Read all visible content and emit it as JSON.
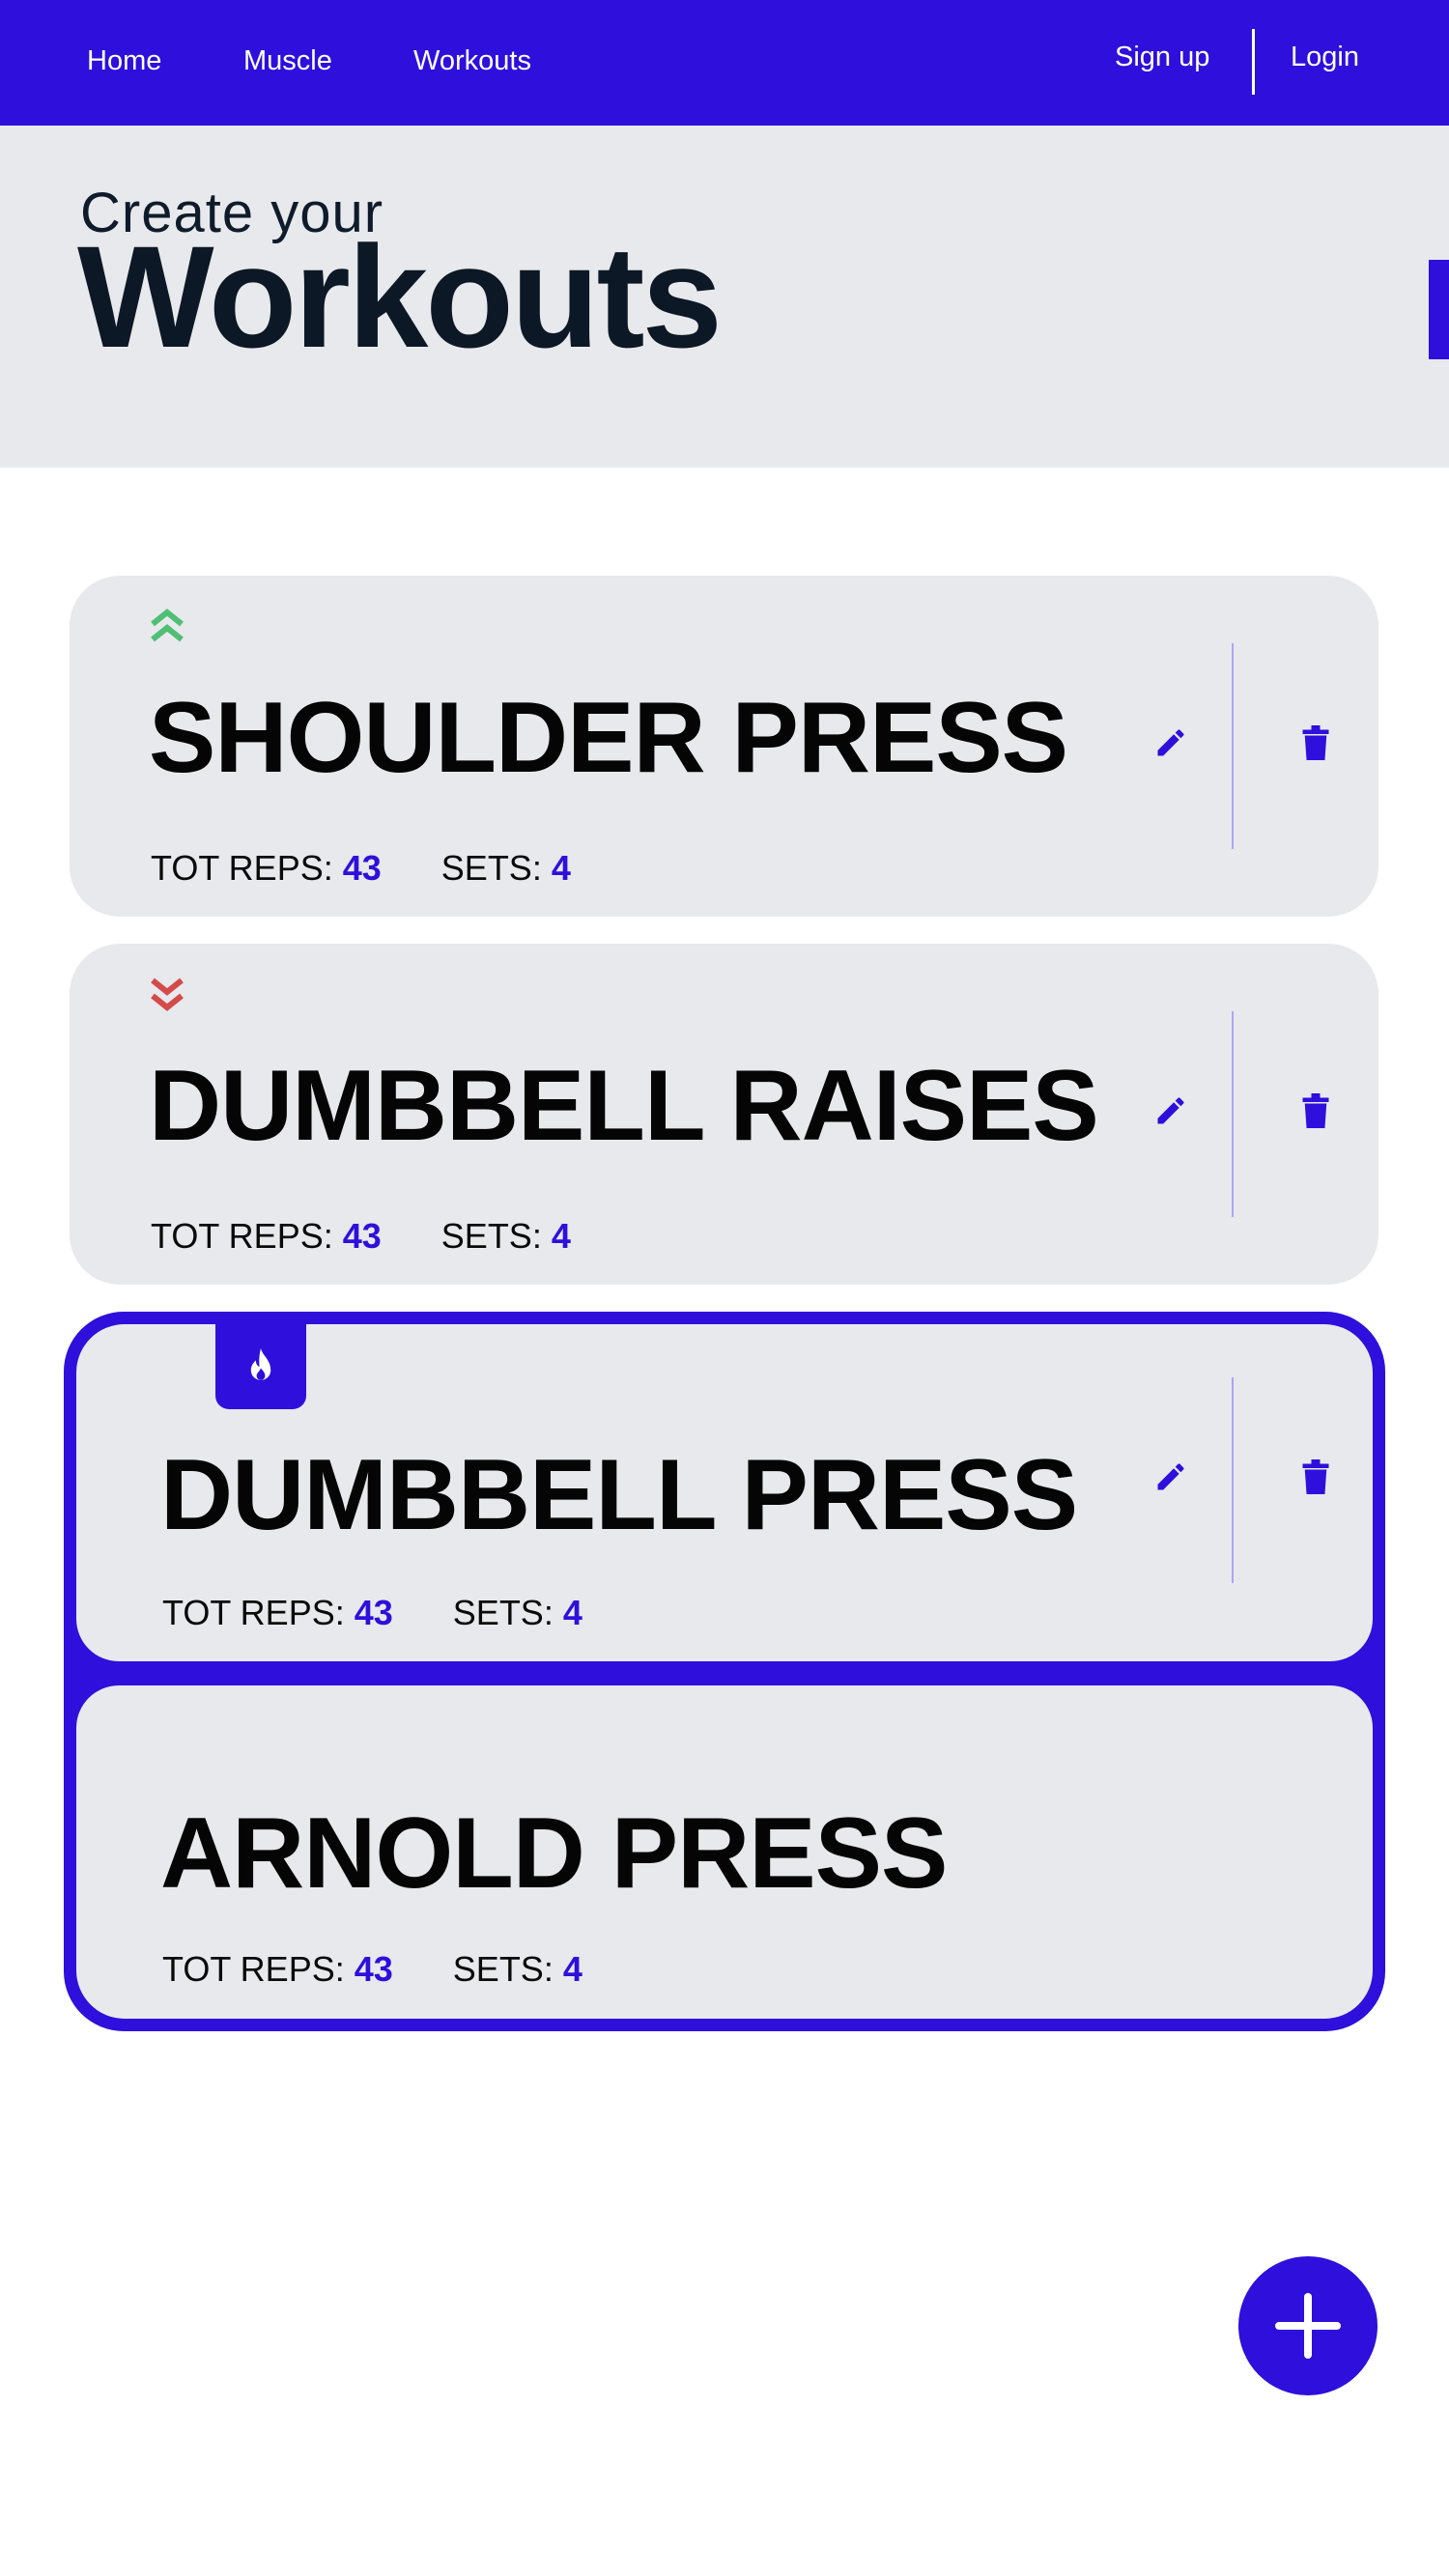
{
  "nav": {
    "links": [
      "Home",
      "Muscle",
      "Workouts"
    ],
    "signup": "Sign up",
    "login": "Login"
  },
  "hero": {
    "subtitle": "Create your",
    "title": "Workouts"
  },
  "labels": {
    "reps": "TOT REPS:",
    "sets": "SETS:"
  },
  "workouts": [
    {
      "name": "SHOULDER PRESS",
      "reps": "43",
      "sets": "4",
      "priority": "up"
    },
    {
      "name": "DUMBBELL RAISES",
      "reps": "43",
      "sets": "4",
      "priority": "down"
    },
    {
      "name": "DUMBBELL PRESS",
      "reps": "43",
      "sets": "4",
      "priority": "hot"
    },
    {
      "name": "ARNOLD PRESS",
      "reps": "43",
      "sets": "4",
      "priority": "none"
    }
  ],
  "icons": {
    "up": "double-chevron-up-icon",
    "down": "double-chevron-down-icon",
    "hot": "fire-icon",
    "edit": "pencil-icon",
    "delete": "trash-icon",
    "add": "plus-icon"
  },
  "colors": {
    "accent": "#2e0fdc",
    "card_bg": "#e8e9ec",
    "priority_up": "#4fbf76",
    "priority_down": "#d44a4a",
    "text_dark": "#0d1826"
  }
}
